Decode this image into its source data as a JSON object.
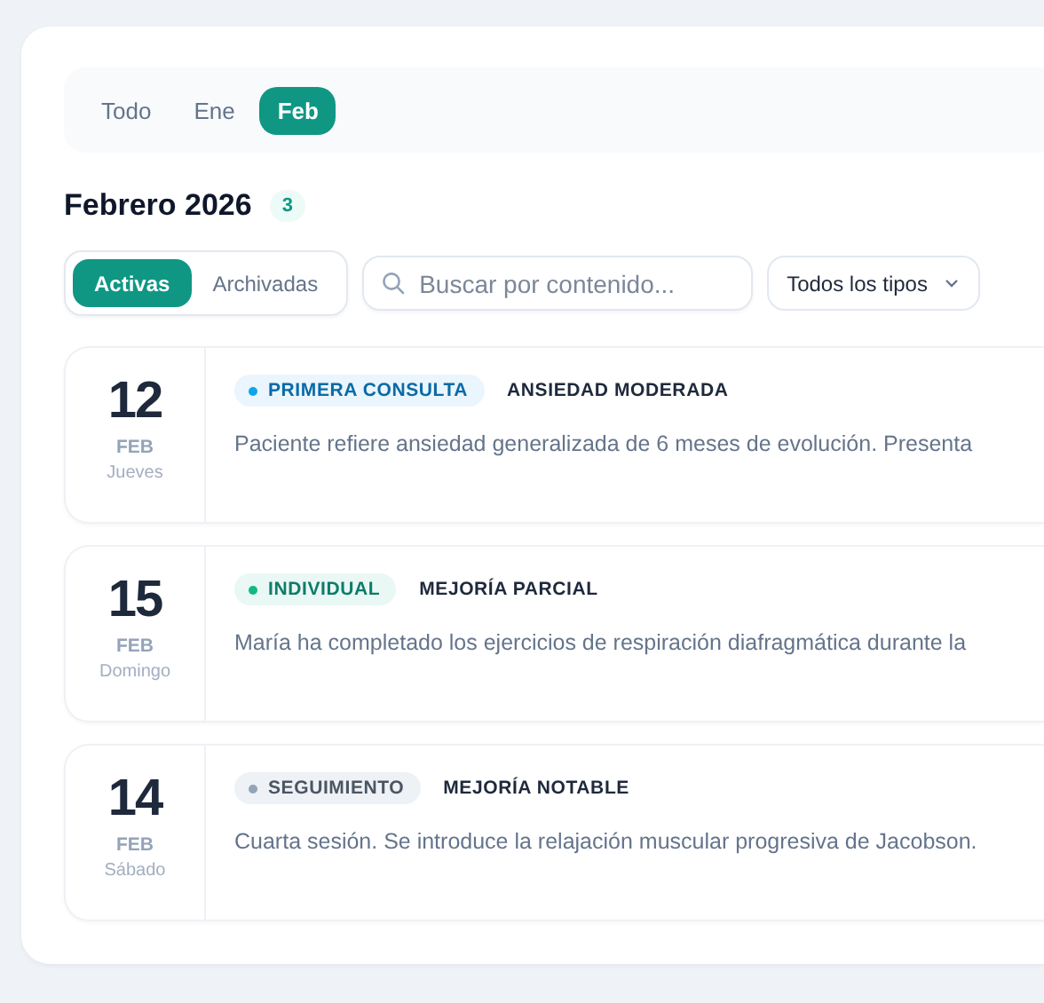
{
  "month_tabs": [
    {
      "label": "Todo",
      "selected": false
    },
    {
      "label": "Ene",
      "selected": false
    },
    {
      "label": "Feb",
      "selected": true
    }
  ],
  "heading": {
    "title": "Febrero 2026",
    "count": "3"
  },
  "status_tabs": [
    {
      "label": "Activas",
      "selected": true
    },
    {
      "label": "Archivadas",
      "selected": false
    }
  ],
  "search": {
    "placeholder": "Buscar por contenido..."
  },
  "type_filter": {
    "value": "Todos los tipos"
  },
  "sessions": [
    {
      "day": "12",
      "month": "FEB",
      "weekday": "Jueves",
      "type": {
        "label": "PRIMERA CONSULTA",
        "kind": "first"
      },
      "assessment": "ANSIEDAD MODERADA",
      "summary": "Paciente refiere ansiedad generalizada de 6 meses de evolución. Presenta"
    },
    {
      "day": "15",
      "month": "FEB",
      "weekday": "Domingo",
      "type": {
        "label": "INDIVIDUAL",
        "kind": "individual"
      },
      "assessment": "MEJORÍA PARCIAL",
      "summary": "María ha completado los ejercicios de respiración diafragmática durante la"
    },
    {
      "day": "14",
      "month": "FEB",
      "weekday": "Sábado",
      "type": {
        "label": "SEGUIMIENTO",
        "kind": "followup"
      },
      "assessment": "MEJORÍA NOTABLE",
      "summary": "Cuarta sesión. Se introduce la relajación muscular progresiva de Jacobson."
    }
  ]
}
